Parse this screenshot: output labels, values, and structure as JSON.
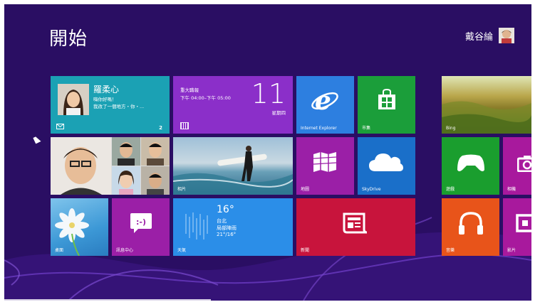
{
  "start": {
    "title": "開始"
  },
  "user": {
    "name": "戴谷綸"
  },
  "tiles": {
    "mail": {
      "contact_name": "羅柔心",
      "line1": "嗨你好嗎！",
      "line2": "我改了一個地方・你・...",
      "count": "2"
    },
    "calendar": {
      "event": "重大職報",
      "time": "下午 04:00–下午 05:00",
      "day": "11",
      "weekday": "星期四"
    },
    "ie": {
      "label": "Internet Explorer"
    },
    "store": {
      "label": "市集"
    },
    "bing": {
      "label": "Bing"
    },
    "photos": {
      "label": "相片"
    },
    "maps": {
      "label": "地圖"
    },
    "skydrive": {
      "label": "SkyDrive"
    },
    "games": {
      "label": "遊戲"
    },
    "camera": {
      "label": "相機"
    },
    "desktop": {
      "label": "桌面"
    },
    "messaging": {
      "label": "訊息中心"
    },
    "weather": {
      "temp": "16°",
      "city": "台北",
      "condition": "局部陣雨",
      "range": "21°/16°",
      "label": "天氣"
    },
    "news": {
      "label": "新聞"
    },
    "music": {
      "label": "音樂"
    },
    "video": {
      "label": "影片"
    }
  },
  "colors": {
    "background": "#2a0e63",
    "mail": "#1ba1b4",
    "calendar": "#8b2fc9",
    "ie": "#2d7fe0",
    "store": "#1b9e3a",
    "maps": "#9b1fa7",
    "skydrive": "#1a6fc9",
    "games": "#1a9e2e",
    "camera": "#a8199d",
    "messaging": "#9b1fa7",
    "weather": "#2b8ee8",
    "news": "#c8143c",
    "music": "#e8541a",
    "video": "#a8199d"
  }
}
